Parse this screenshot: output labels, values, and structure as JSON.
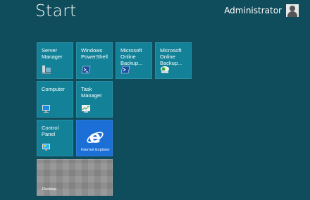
{
  "header": {
    "title": "Start",
    "user_name": "Administrator",
    "user_icon": "user-avatar-icon"
  },
  "tiles": [
    {
      "label": "Server\nManager",
      "icon": "server-manager-icon"
    },
    {
      "label": "Windows\nPowerShell",
      "icon": "powershell-icon"
    },
    {
      "label": "Microsoft\nOnline\nBackup...",
      "icon": "online-backup-shell-icon"
    },
    {
      "label": "Microsoft\nOnline\nBackup...",
      "icon": "online-backup-icon"
    },
    {
      "label": "Computer",
      "icon": "computer-icon"
    },
    {
      "label": "Task\nManager",
      "icon": "task-manager-icon"
    },
    {
      "label": "Control\nPanel",
      "icon": "control-panel-icon"
    },
    {
      "label": "Internet Explorer",
      "icon": "internet-explorer-icon"
    },
    {
      "label": "Desktop",
      "icon": "desktop-icon"
    }
  ],
  "colors": {
    "background": "#0f4c5c",
    "tile": "#138299",
    "ie_tile": "#1b6fd6",
    "desktop_tile": "#8f8f8f"
  }
}
